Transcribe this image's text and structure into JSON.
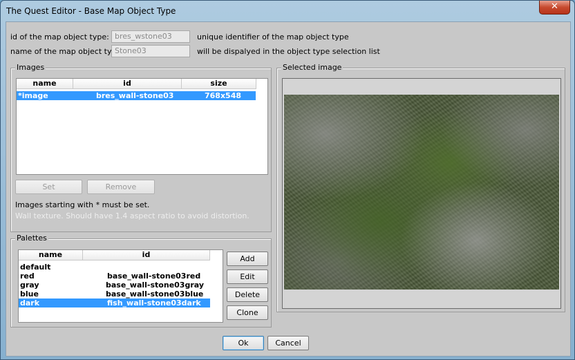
{
  "window": {
    "title": "The Quest Editor - Base Map Object Type",
    "close_glyph": "✕"
  },
  "form": {
    "id_label": "id of the map object type:",
    "id_value": "bres_wstone03",
    "id_hint": "unique identifier of the map object type",
    "name_label": "name of the map object type:",
    "name_value": "Stone03",
    "name_hint": "will be dispalyed in the object type selection list"
  },
  "images": {
    "group_title": "Images",
    "columns": [
      "name",
      "id",
      "size"
    ],
    "rows": [
      {
        "name": "*image",
        "id": "bres_wall-stone03",
        "size": "768x548",
        "selected": true
      }
    ],
    "set_button": "Set",
    "remove_button": "Remove",
    "note": "Images starting with * must be set.",
    "description": "Wall texture. Should have 1.4 aspect ratio to avoid distortion."
  },
  "palettes": {
    "group_title": "Palettes",
    "columns": [
      "name",
      "id"
    ],
    "rows": [
      {
        "name": "default",
        "id": ""
      },
      {
        "name": "red",
        "id": "base_wall-stone03red"
      },
      {
        "name": "gray",
        "id": "base_wall-stone03gray"
      },
      {
        "name": "blue",
        "id": "base_wall-stone03blue"
      },
      {
        "name": "dark",
        "id": "fish_wall-stone03dark",
        "selected": true
      }
    ],
    "add_button": "Add",
    "edit_button": "Edit",
    "delete_button": "Delete",
    "clone_button": "Clone"
  },
  "selected_image": {
    "group_title": "Selected image"
  },
  "footer": {
    "ok_button": "Ok",
    "cancel_button": "Cancel"
  },
  "colors": {
    "selection": "#3399ff",
    "title_gradient": "#aecbe0",
    "close_button": "#c74a2f"
  }
}
